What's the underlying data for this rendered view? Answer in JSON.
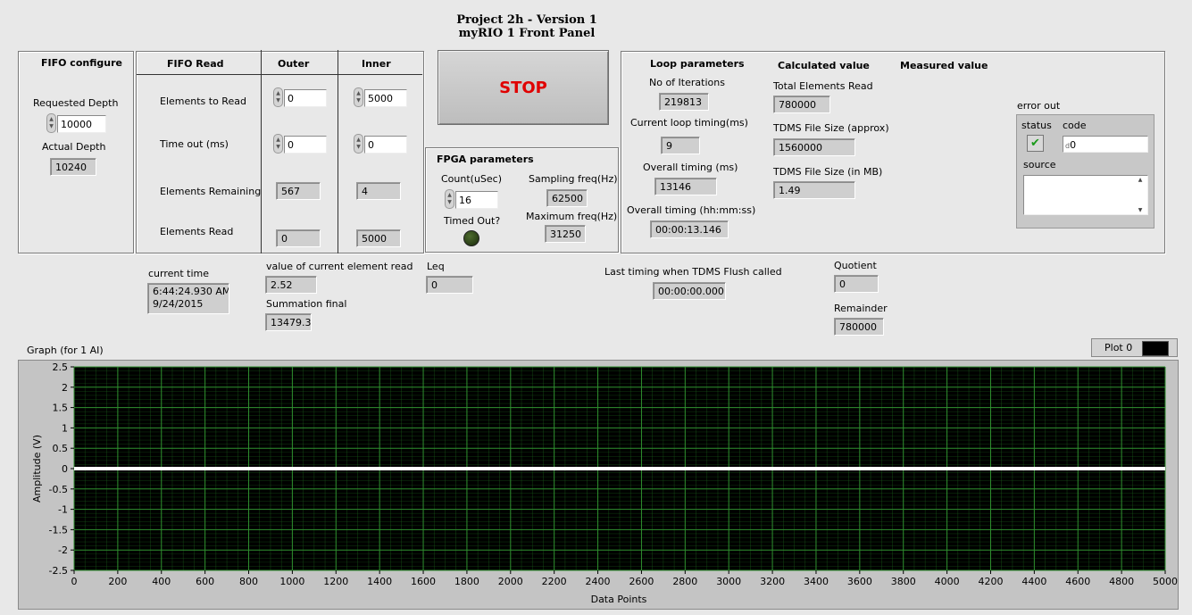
{
  "header": {
    "title_line1": "Project 2h - Version 1",
    "title_line2": "myRIO 1 Front Panel"
  },
  "fifo_configure": {
    "heading": "FIFO configure",
    "requested_depth_label": "Requested Depth",
    "requested_depth_value": "10000",
    "actual_depth_label": "Actual Depth",
    "actual_depth_value": "10240"
  },
  "fifo_read": {
    "heading": "FIFO Read",
    "col_outer": "Outer",
    "col_inner": "Inner",
    "rows": [
      {
        "label": "Elements to Read",
        "outer": "0",
        "inner": "5000"
      },
      {
        "label": "Time out (ms)",
        "outer": "0",
        "inner": "0"
      },
      {
        "label": "Elements Remaining",
        "outer": "567",
        "inner": "4"
      },
      {
        "label": "Elements Read",
        "outer": "0",
        "inner": "5000"
      }
    ]
  },
  "stop_button": {
    "label": "STOP"
  },
  "fpga": {
    "heading": "FPGA parameters",
    "count_label": "Count(uSec)",
    "count_value": "16",
    "timed_out_label": "Timed Out?",
    "sampling_label": "Sampling freq(Hz)",
    "sampling_value": "62500",
    "max_label": "Maximum freq(Hz)",
    "max_value": "31250"
  },
  "loop": {
    "heading": "Loop parameters",
    "calc_heading": "Calculated value",
    "meas_heading": "Measured value",
    "iterations_label": "No of Iterations",
    "iterations_value": "219813",
    "current_timing_label": "Current loop timing(ms)",
    "current_timing_value": "9",
    "overall_ms_label": "Overall timing (ms)",
    "overall_ms_value": "13146",
    "overall_hms_label": "Overall timing (hh:mm:ss)",
    "overall_hms_value": "00:00:13.146",
    "total_label": "Total Elements Read",
    "total_value": "780000",
    "tdms_approx_label": "TDMS File Size (approx)",
    "tdms_approx_value": "1560000",
    "tdms_mb_label": "TDMS File Size (in MB)",
    "tdms_mb_value": "1.49"
  },
  "error_out": {
    "heading": "error out",
    "status_label": "status",
    "code_label": "code",
    "code_value": "0",
    "code_prefix": "d",
    "source_label": "source",
    "status_icon": "checkmark-icon"
  },
  "misc": {
    "current_time_label": "current time",
    "current_time_line1": "6:44:24.930 AM",
    "current_time_line2": "9/24/2015",
    "current_value_label": "value of current element read",
    "current_value": "2.52",
    "summation_label": "Summation final",
    "summation_value": "13479.35",
    "leq_label": "Leq",
    "leq_value": "0",
    "flush_label": "Last timing when TDMS Flush called",
    "flush_value": "00:00:00.000",
    "quotient_label": "Quotient",
    "quotient_value": "0",
    "remainder_label": "Remainder",
    "remainder_value": "780000"
  },
  "graph": {
    "label": "Graph (for 1 AI)",
    "plot_legend": "Plot 0"
  },
  "chart_data": {
    "type": "line",
    "xlabel": "Data Points",
    "ylabel": "Amplitude (V)",
    "xlim": [
      0,
      5000
    ],
    "ylim": [
      -2.5,
      2.5
    ],
    "x_ticks": [
      0,
      200,
      400,
      600,
      800,
      1000,
      1200,
      1400,
      1600,
      1800,
      2000,
      2200,
      2400,
      2600,
      2800,
      3000,
      3200,
      3400,
      3600,
      3800,
      4000,
      4200,
      4400,
      4600,
      4800,
      5000
    ],
    "y_ticks": [
      2.5,
      2,
      1.5,
      1,
      0.5,
      0,
      -0.5,
      -1,
      -1.5,
      -2,
      -2.5
    ],
    "y_tick_labels": [
      "2.5",
      "2",
      "1.5",
      "1",
      "0.5",
      "0",
      "-0.5",
      "-1",
      "-1.5",
      "-2",
      "-2.5"
    ],
    "grid": true,
    "background": "#000000",
    "grid_color": "#1e6b1e",
    "series": [
      {
        "name": "Plot 0",
        "color": "#ffffff",
        "x": [
          0,
          5000
        ],
        "y": [
          0,
          0
        ]
      }
    ]
  }
}
